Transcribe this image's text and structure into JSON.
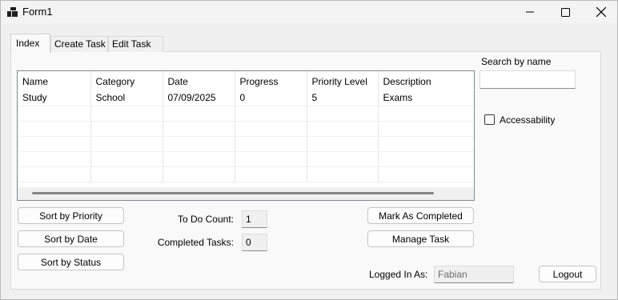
{
  "window": {
    "title": "Form1"
  },
  "tabs": [
    {
      "label": "Index",
      "active": true
    },
    {
      "label": "Create Task"
    },
    {
      "label": "Edit Task"
    }
  ],
  "tasks_grid": {
    "columns": [
      "Name",
      "Category",
      "Date",
      "Progress",
      "Priority Level",
      "Description"
    ],
    "rows": [
      [
        "Study",
        "School",
        "07/09/2025",
        "0",
        "5",
        "Exams"
      ]
    ]
  },
  "sort": {
    "by_priority": "Sort by Priority",
    "by_date": "Sort by Date",
    "by_status": "Sort by Status"
  },
  "counts": {
    "todo_label": "To Do Count:",
    "todo_value": "1",
    "completed_label": "Completed Tasks:",
    "completed_value": "0"
  },
  "actions": {
    "mark_completed": "Mark As Completed",
    "manage_task": "Manage Task",
    "logout": "Logout"
  },
  "search": {
    "label": "Search by name",
    "value": ""
  },
  "accessibility": {
    "label": "Accessability",
    "checked": false
  },
  "user": {
    "label": "Logged In As:",
    "value": "Fabian"
  }
}
